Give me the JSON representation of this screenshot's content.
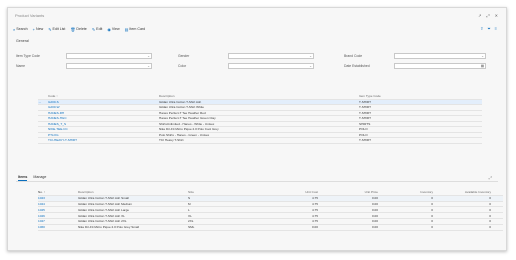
{
  "page": {
    "title": "Product Variants",
    "window_controls": [
      "↗",
      "⤢",
      "✕"
    ]
  },
  "actions": [
    {
      "icon": "search-icon",
      "glyph": "⌕",
      "label": "Search"
    },
    {
      "icon": "plus-icon",
      "glyph": "+",
      "label": "New"
    },
    {
      "icon": "edit-icon",
      "glyph": "✎",
      "label": "Edit List"
    },
    {
      "icon": "delete-icon",
      "glyph": "🗑",
      "label": "Delete"
    },
    {
      "icon": "edit-icon",
      "glyph": "✎",
      "label": "Edit"
    },
    {
      "icon": "view-icon",
      "glyph": "◉",
      "label": "View"
    },
    {
      "icon": "item-card-icon",
      "glyph": "▤",
      "label": "Item Card"
    }
  ],
  "right_icons": [
    "share-icon",
    "filter-icon",
    "list-icon"
  ],
  "section_label": "General",
  "filters": {
    "item_type_code": {
      "label": "Item Type Code",
      "value": ""
    },
    "name": {
      "label": "Name",
      "value": ""
    },
    "gender": {
      "label": "Gender",
      "value": ""
    },
    "color": {
      "label": "Color",
      "value": ""
    },
    "brand_code": {
      "label": "Brand Code",
      "value": ""
    },
    "date_established": {
      "label": "Date Established",
      "value": ""
    }
  },
  "top_grid": {
    "headers": [
      "Code ↑",
      "Description",
      "Item Type Code"
    ],
    "rows": [
      {
        "marker": "→",
        "code": "G200-S",
        "description": "Gildan Ultra Cotton T-Shirt Ash",
        "type": "T-SHIRT"
      },
      {
        "marker": "",
        "code": "G200-W",
        "description": "Gildan Ultra Cotton T-Shirt White",
        "type": "T-SHIRT"
      },
      {
        "marker": "",
        "code": "HANES-RH",
        "description": "Hanes Perfect-T Tee Heather Red",
        "type": "T-SHIRT"
      },
      {
        "marker": "",
        "code": "HANES-HGC",
        "description": "Hanes Perfect-T Tee Heather Green Clay",
        "type": "T-SHIRT"
      },
      {
        "marker": "",
        "code": "HANES_T_S",
        "description": "ShirtsUnlimited - Hanes - White - Unisex",
        "type": "SHIRTS"
      },
      {
        "marker": "",
        "code": "NIKE-TEE-CC",
        "description": "Nike Dri-Fit Micro Pique 2.0 Polo Cool Grey",
        "type": "POLO"
      },
      {
        "marker": "",
        "code": "PTLOG",
        "description": "Polo Shirts - Hanes - Green - Unisex",
        "type": "POLO"
      },
      {
        "marker": "",
        "code": "TCI-HEAVY-T-SHIRT",
        "description": "TCI Heavy T-Shirt",
        "type": "T-SHIRT"
      }
    ]
  },
  "tabs": [
    {
      "label": "Items",
      "active": true
    },
    {
      "label": "Manage",
      "active": false
    }
  ],
  "bottom_grid": {
    "headers": [
      "No. ↑",
      "Description",
      "Size",
      "Unit Cost",
      "Unit Price",
      "Inventory",
      "Available Inventory"
    ],
    "rows": [
      {
        "no": "1023",
        "description": "Gildan Ultra Cotton T-Shirt Ash Small",
        "size": "S",
        "unit_cost": "4.75",
        "unit_price": "0.00",
        "inventory": "0",
        "available": "0"
      },
      {
        "no": "1024",
        "description": "Gildan Ultra Cotton T-Shirt Ash Medium",
        "size": "M",
        "unit_cost": "4.75",
        "unit_price": "0.00",
        "inventory": "0",
        "available": "0"
      },
      {
        "no": "1025",
        "description": "Gildan Ultra Cotton T-Shirt Ash Large",
        "size": "L",
        "unit_cost": "4.75",
        "unit_price": "0.00",
        "inventory": "0",
        "available": "0"
      },
      {
        "no": "1026",
        "description": "Gildan Ultra Cotton T-Shirt Ash XL",
        "size": "XL",
        "unit_cost": "4.75",
        "unit_price": "0.00",
        "inventory": "0",
        "available": "0"
      },
      {
        "no": "1027",
        "description": "Gildan Ultra Cotton T-Shirt Ash 2XL",
        "size": "2XL",
        "unit_cost": "4.75",
        "unit_price": "0.00",
        "inventory": "0",
        "available": "0"
      },
      {
        "no": "1060",
        "description": "Nike Dri-Fit Micro Pique 2.0 Polo Grey Small",
        "size": "SML",
        "unit_cost": "0.00",
        "unit_price": "0.00",
        "inventory": "0",
        "available": "0"
      }
    ]
  }
}
